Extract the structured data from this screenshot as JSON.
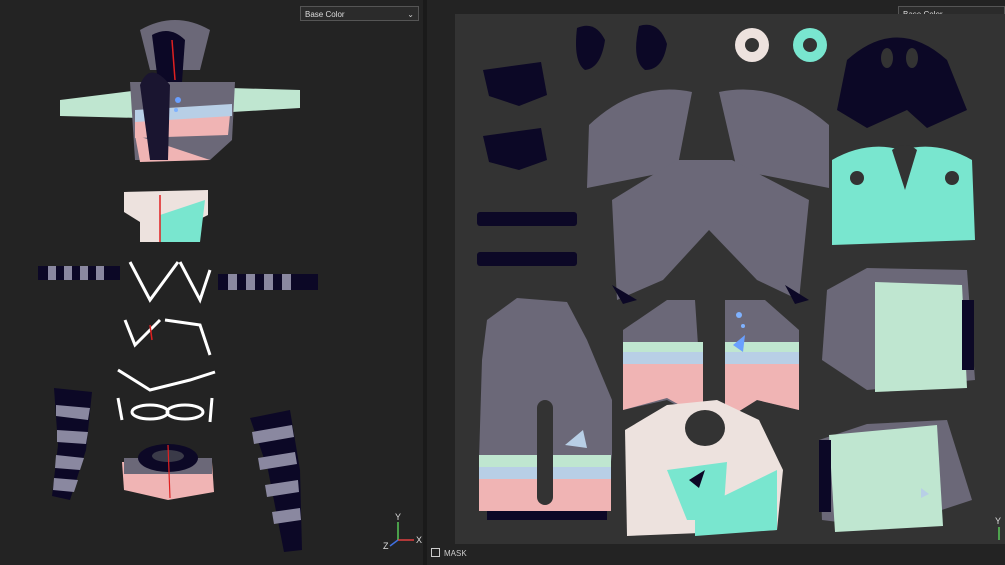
{
  "viewport_3d": {
    "channel_label": "Base Color",
    "axis": {
      "y": "Y",
      "x": "X",
      "z": "Z"
    }
  },
  "viewport_2d": {
    "channel_label": "Base Color",
    "axis": {
      "y": "Y"
    },
    "mask_label": "MASK"
  },
  "colors": {
    "lavender_gray": "#6b6878",
    "mint": "#79e6cf",
    "pale_mint": "#bfe6d0",
    "pink": "#f0b4b4",
    "pale_blue": "#b8cfe6",
    "cream": "#ede2de",
    "navy": "#0c0826",
    "bg": "#232323",
    "uv_bg": "#333333"
  }
}
